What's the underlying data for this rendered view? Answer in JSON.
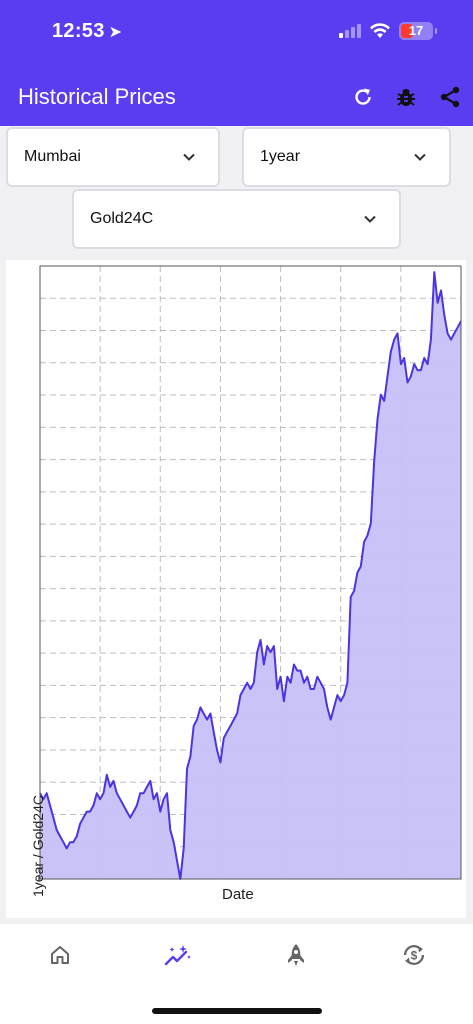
{
  "status_bar": {
    "time": "12:53",
    "battery": "17"
  },
  "header": {
    "title": "Historical Prices",
    "actions": [
      "refresh-icon",
      "bug-icon",
      "share-icon"
    ]
  },
  "filters": {
    "city": "Mumbai",
    "period": "1year",
    "metal": "Gold24C"
  },
  "colors": {
    "primary": "#5b3df1",
    "line": "#4a35e0",
    "fill": "#c6c0f7"
  },
  "chart_data": {
    "type": "area",
    "xlabel": "Date",
    "ylabel": "1year / Gold24C",
    "grid": true,
    "y_tick_labels_visible": false,
    "x_tick_labels_visible": false,
    "ylim": [
      0,
      100
    ],
    "series": [
      {
        "values": [
          14,
          13,
          14,
          12,
          10,
          8,
          7,
          6,
          5,
          6,
          6,
          7,
          9,
          10,
          11,
          11,
          12,
          14,
          13,
          14,
          17,
          15,
          16,
          14,
          13,
          12,
          11,
          10,
          11,
          12,
          14,
          14,
          15,
          16,
          13,
          14,
          11,
          13,
          14,
          8,
          6,
          3,
          0,
          5,
          18,
          20,
          25,
          26,
          28,
          27,
          26,
          27,
          24,
          21,
          19,
          23,
          24,
          25,
          26,
          27,
          30,
          31,
          32,
          31,
          32,
          37,
          39,
          35,
          38,
          37,
          38,
          31,
          33,
          29,
          33,
          32,
          35,
          34,
          34,
          32,
          33,
          31,
          31,
          33,
          32,
          31,
          28,
          26,
          28,
          30,
          29,
          30,
          32,
          46,
          47,
          50,
          51,
          55,
          56,
          58,
          68,
          75,
          79,
          78,
          82,
          86,
          88,
          89,
          84,
          85,
          81,
          82,
          84,
          83,
          83,
          85,
          84,
          88,
          99,
          94,
          96,
          92,
          89,
          88,
          89,
          90,
          91
        ]
      }
    ]
  },
  "bottom_nav": {
    "items": [
      "home-icon",
      "trend-sparkle-icon",
      "rocket-icon",
      "currency-exchange-icon"
    ],
    "active_index": 1
  }
}
